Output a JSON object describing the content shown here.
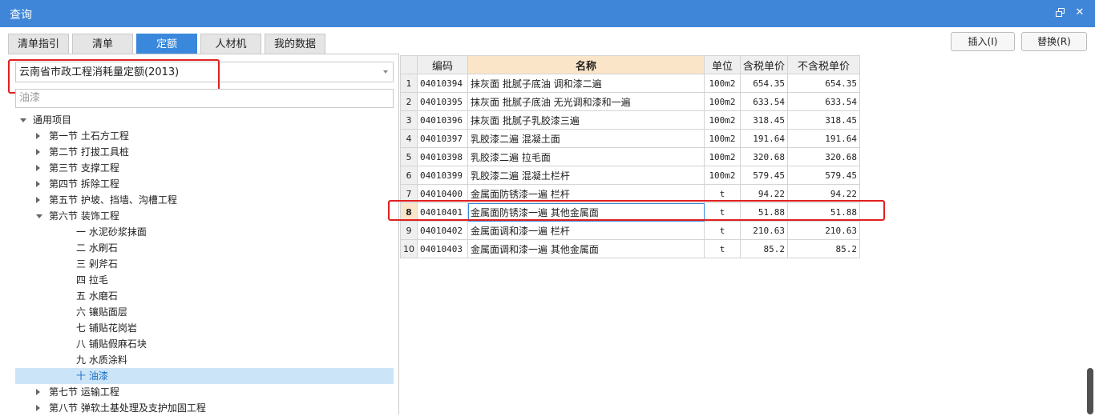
{
  "window": {
    "title": "查询"
  },
  "tabs": [
    "清单指引",
    "清单",
    "定额",
    "人材机",
    "我的数据"
  ],
  "buttons": {
    "insert": "插入(I)",
    "replace": "替换(R)"
  },
  "library_select": {
    "value": "云南省市政工程消耗量定额(2013)"
  },
  "search": {
    "value": "油漆"
  },
  "tree": [
    {
      "label": "通用项目",
      "level": 0,
      "expanded": true
    },
    {
      "label": "第一节 土石方工程",
      "level": 1,
      "expanded": false
    },
    {
      "label": "第二节 打拔工具桩",
      "level": 1,
      "expanded": false
    },
    {
      "label": "第三节 支撑工程",
      "level": 1,
      "expanded": false
    },
    {
      "label": "第四节 拆除工程",
      "level": 1,
      "expanded": false
    },
    {
      "label": "第五节 护坡、挡墙、沟槽工程",
      "level": 1,
      "expanded": false
    },
    {
      "label": "第六节 装饰工程",
      "level": 1,
      "expanded": true
    },
    {
      "label": "一 水泥砂浆抹面",
      "level": 2
    },
    {
      "label": "二 水刷石",
      "level": 2
    },
    {
      "label": "三 剁斧石",
      "level": 2
    },
    {
      "label": "四 拉毛",
      "level": 2
    },
    {
      "label": "五 水磨石",
      "level": 2
    },
    {
      "label": "六 镶贴面层",
      "level": 2
    },
    {
      "label": "七 铺贴花岗岩",
      "level": 2
    },
    {
      "label": "八 铺贴假麻石块",
      "level": 2
    },
    {
      "label": "九 水质涂料",
      "level": 2
    },
    {
      "label": "十 油漆",
      "level": 2,
      "selected": true
    },
    {
      "label": "第七节 运输工程",
      "level": 1,
      "expanded": false
    },
    {
      "label": "第八节 弹软土基处理及支护加固工程",
      "level": 1,
      "expanded": false
    }
  ],
  "grid": {
    "headers": {
      "code": "编码",
      "name": "名称",
      "unit": "单位",
      "price_tax": "含税单价",
      "price_notax": "不含税单价"
    },
    "rows": [
      {
        "no": "1",
        "code": "04010394",
        "name": "抹灰面 批腻子底油 调和漆二遍",
        "unit": "100m2",
        "price_tax": "654.35",
        "price_notax": "654.35"
      },
      {
        "no": "2",
        "code": "04010395",
        "name": "抹灰面 批腻子底油 无光调和漆和一遍",
        "unit": "100m2",
        "price_tax": "633.54",
        "price_notax": "633.54"
      },
      {
        "no": "3",
        "code": "04010396",
        "name": "抹灰面 批腻子乳胶漆三遍",
        "unit": "100m2",
        "price_tax": "318.45",
        "price_notax": "318.45"
      },
      {
        "no": "4",
        "code": "04010397",
        "name": "乳胶漆二遍 混凝土面",
        "unit": "100m2",
        "price_tax": "191.64",
        "price_notax": "191.64"
      },
      {
        "no": "5",
        "code": "04010398",
        "name": "乳胶漆二遍 拉毛面",
        "unit": "100m2",
        "price_tax": "320.68",
        "price_notax": "320.68"
      },
      {
        "no": "6",
        "code": "04010399",
        "name": "乳胶漆二遍 混凝土栏杆",
        "unit": "100m2",
        "price_tax": "579.45",
        "price_notax": "579.45"
      },
      {
        "no": "7",
        "code": "04010400",
        "name": "金属面防锈漆一遍 栏杆",
        "unit": "t",
        "price_tax": "94.22",
        "price_notax": "94.22"
      },
      {
        "no": "8",
        "code": "04010401",
        "name": "金属面防锈漆一遍 其他金属面",
        "unit": "t",
        "price_tax": "51.88",
        "price_notax": "51.88",
        "current": true
      },
      {
        "no": "9",
        "code": "04010402",
        "name": "金属面调和漆一遍 栏杆",
        "unit": "t",
        "price_tax": "210.63",
        "price_notax": "210.63"
      },
      {
        "no": "10",
        "code": "04010403",
        "name": "金属面调和漆一遍 其他金属面",
        "unit": "t",
        "price_tax": "85.2",
        "price_notax": "85.2"
      }
    ]
  },
  "colors": {
    "titlebar": "#3f86d8",
    "active_tab": "#3a88dc",
    "highlight_box": "#e02020",
    "name_header": "#fbe5c8",
    "selected_tree": "#cce4f7"
  }
}
